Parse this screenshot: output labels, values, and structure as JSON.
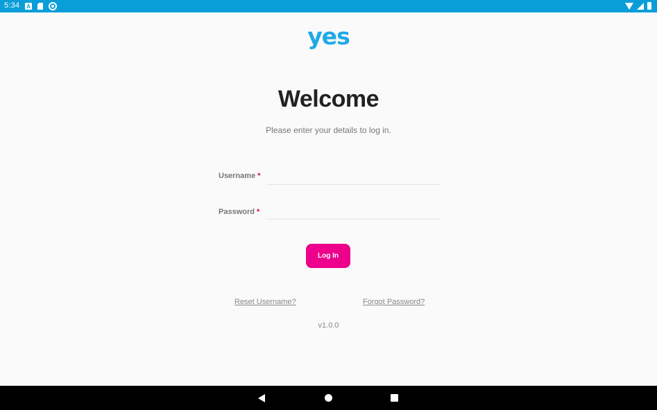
{
  "status_bar": {
    "time": "5:34",
    "notification_icon_letter": "A",
    "icons_left": [
      "a-icon",
      "sd-card-icon",
      "sync-icon"
    ],
    "icons_right": [
      "wifi-icon",
      "signal-icon",
      "battery-icon"
    ],
    "background_color": "#0a9ed9"
  },
  "logo": {
    "text": "yes",
    "color": "#1fa9e6"
  },
  "header": {
    "title": "Welcome",
    "subtitle": "Please enter your details to log in."
  },
  "form": {
    "username": {
      "label": "Username",
      "required_mark": "*",
      "value": ""
    },
    "password": {
      "label": "Password",
      "required_mark": "*",
      "value": ""
    },
    "login_button": {
      "label": "Log In",
      "color": "#ec008c"
    }
  },
  "links": {
    "reset_username": "Reset Username?",
    "forgot_password": "Forgot Password?"
  },
  "version": "v1.0.0",
  "nav_bar": {
    "buttons": [
      "back-icon",
      "home-icon",
      "recents-icon"
    ]
  }
}
